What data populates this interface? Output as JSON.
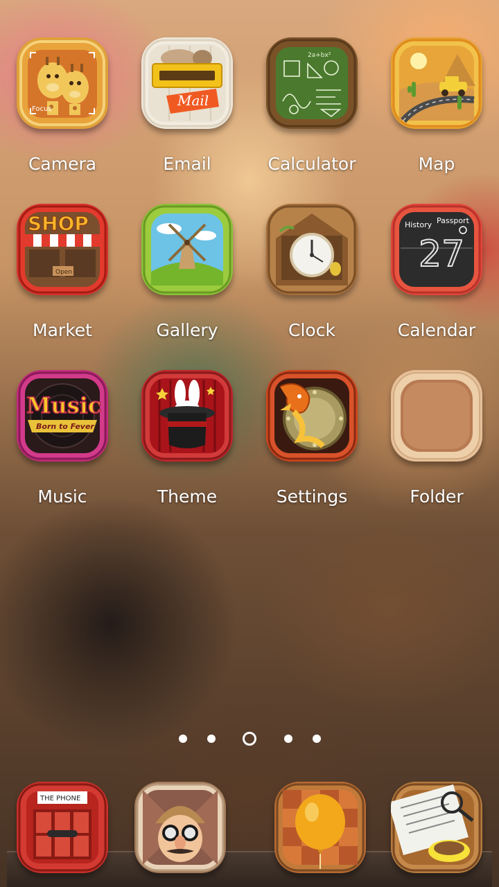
{
  "apps": [
    {
      "label": "Camera",
      "icon": "giraffe-camera-icon"
    },
    {
      "label": "Email",
      "icon": "mail-icon"
    },
    {
      "label": "Calculator",
      "icon": "chalkboard-calculator-icon"
    },
    {
      "label": "Map",
      "icon": "desert-map-icon"
    },
    {
      "label": "Market",
      "icon": "shop-market-icon"
    },
    {
      "label": "Gallery",
      "icon": "windmill-gallery-icon"
    },
    {
      "label": "Clock",
      "icon": "wooden-clock-icon"
    },
    {
      "label": "Calendar",
      "icon": "calendar-icon"
    },
    {
      "label": "Music",
      "icon": "music-icon"
    },
    {
      "label": "Theme",
      "icon": "magic-hat-theme-icon"
    },
    {
      "label": "Settings",
      "icon": "dragon-settings-icon"
    },
    {
      "label": "Folder",
      "icon": "folder-icon"
    }
  ],
  "icon_text": {
    "camera_focus": "Focus",
    "email_mail": "Mail",
    "calc_formula": "2a+bx²",
    "market_shop": "SHOP",
    "market_open": "Open",
    "calendar_history": "History",
    "calendar_passport": "Passport",
    "calendar_day": "27",
    "music_title": "Music",
    "music_tagline": "Born to Fever",
    "phone_label": "THE PHONE"
  },
  "pager": {
    "pages": 5,
    "current": 3
  },
  "dock": [
    {
      "icon": "phone-booth-icon"
    },
    {
      "icon": "contacts-disguise-icon"
    },
    {
      "icon": "balloon-browser-icon"
    },
    {
      "icon": "newspaper-coffee-icon"
    }
  ]
}
